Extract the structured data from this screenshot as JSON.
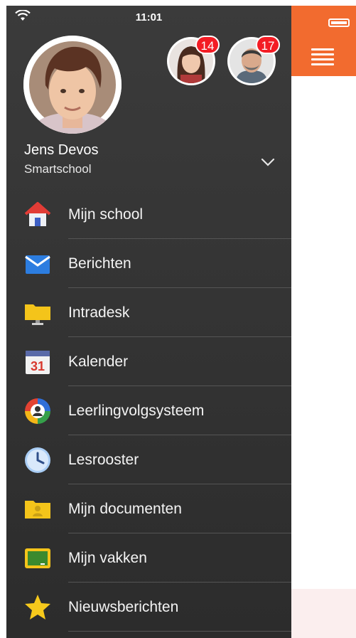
{
  "status_bar": {
    "time": "11:01"
  },
  "profile": {
    "name": "Jens Devos",
    "school": "Smartschool"
  },
  "accounts": [
    {
      "badge": "14"
    },
    {
      "badge": "17"
    }
  ],
  "menu": [
    {
      "label": "Mijn school",
      "icon": "home-icon"
    },
    {
      "label": "Berichten",
      "icon": "mail-icon"
    },
    {
      "label": "Intradesk",
      "icon": "folder-screen-icon"
    },
    {
      "label": "Kalender",
      "icon": "calendar-icon",
      "icon_text": "31"
    },
    {
      "label": "Leerlingvolgsysteem",
      "icon": "student-tracking-icon"
    },
    {
      "label": "Lesrooster",
      "icon": "clock-icon"
    },
    {
      "label": "Mijn documenten",
      "icon": "documents-folder-icon"
    },
    {
      "label": "Mijn vakken",
      "icon": "blackboard-icon"
    },
    {
      "label": "Nieuwsberichten",
      "icon": "star-icon"
    }
  ],
  "colors": {
    "drawer_bg": "#333333",
    "accent_orange": "#f26b2f",
    "badge_red": "#f31c24"
  }
}
